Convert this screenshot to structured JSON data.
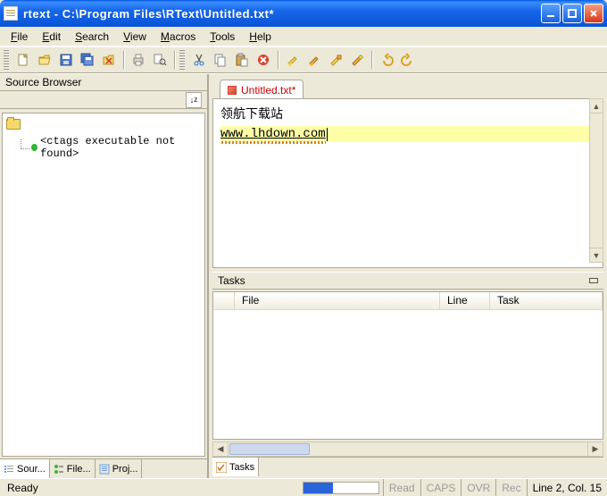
{
  "titlebar": {
    "text": "rtext - C:\\Program Files\\RText\\Untitled.txt*"
  },
  "menu": {
    "file": "File",
    "edit": "Edit",
    "search": "Search",
    "view": "View",
    "macros": "Macros",
    "tools": "Tools",
    "help": "Help"
  },
  "panels": {
    "source_browser": {
      "title": "Source Browser",
      "error": "<ctags executable not found>"
    },
    "tasks": {
      "title": "Tasks",
      "cols": {
        "file": "File",
        "line": "Line",
        "task": "Task"
      }
    }
  },
  "tabs": {
    "left": {
      "source": "Sour...",
      "file": "File...",
      "proj": "Proj..."
    },
    "bottom": {
      "tasks": "Tasks"
    },
    "doc": {
      "label": "Untitled.txt*"
    }
  },
  "editor": {
    "line1": "领航下载站",
    "line2": "www.lhdown.com"
  },
  "status": {
    "ready": "Ready",
    "read": "Read",
    "caps": "CAPS",
    "ovr": "OVR",
    "rec": "Rec",
    "pos": "Line 2, Col. 15",
    "progress_pct": 40
  },
  "icons": {
    "new": "new-icon",
    "open": "open-icon",
    "save": "save-icon",
    "saveall": "saveall-icon",
    "openfolder": "openfolder-icon",
    "options": "options-icon",
    "snapshot": "snapshot-icon",
    "cut": "cut-icon",
    "copy": "copy-icon",
    "paste": "paste-icon",
    "delete": "delete-icon",
    "find": "find-icon",
    "findnext": "findnext-icon",
    "replace": "replace-icon",
    "goto": "goto-icon",
    "undo": "undo-icon",
    "redo": "redo-icon"
  }
}
